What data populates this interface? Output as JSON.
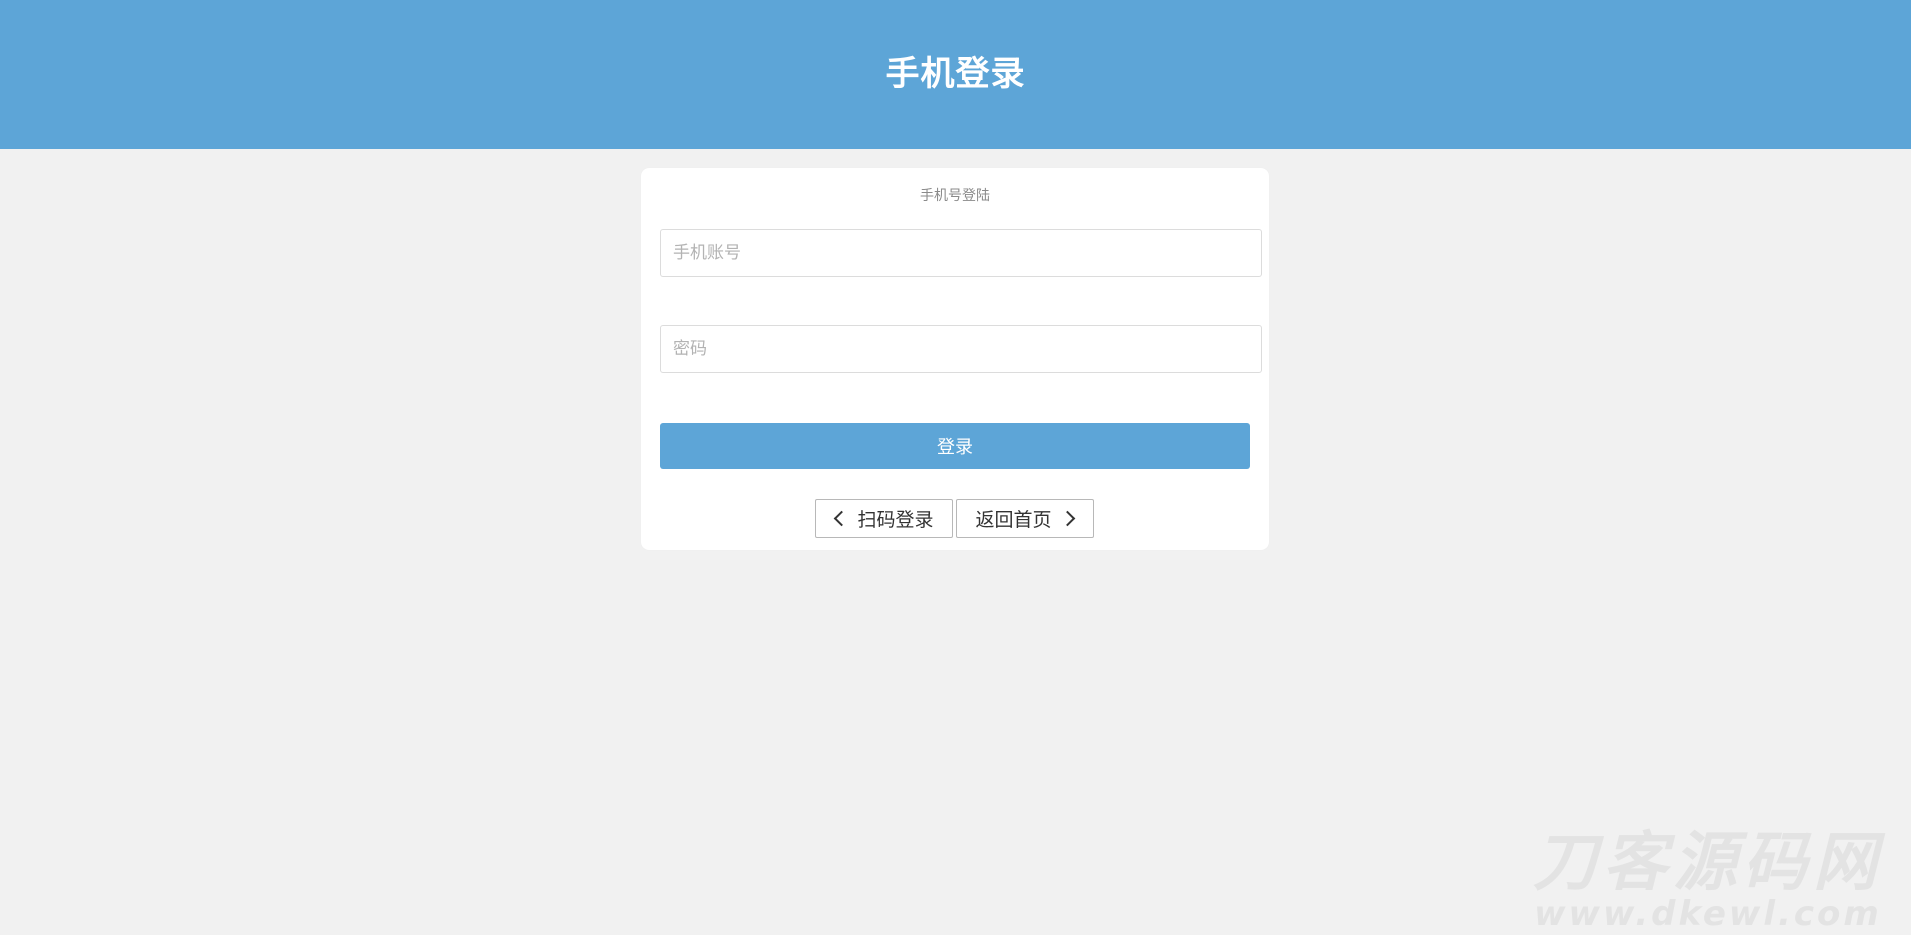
{
  "header": {
    "title": "手机登录"
  },
  "login_card": {
    "subtitle": "手机号登陆",
    "phone_field": {
      "placeholder": "手机账号",
      "value": ""
    },
    "password_field": {
      "placeholder": "密码",
      "value": ""
    },
    "login_button_label": "登录",
    "scan_login_label": "扫码登录",
    "back_home_label": "返回首页"
  },
  "watermark": {
    "main": "刀客源码网",
    "sub": "www.dkewl.com"
  },
  "colors": {
    "header_bg": "#5da5d7",
    "page_bg": "#f1f1f1",
    "button_bg": "#5da5d7"
  },
  "icons": {
    "scan_login": "chevron-left-icon",
    "back_home": "chevron-right-icon"
  }
}
